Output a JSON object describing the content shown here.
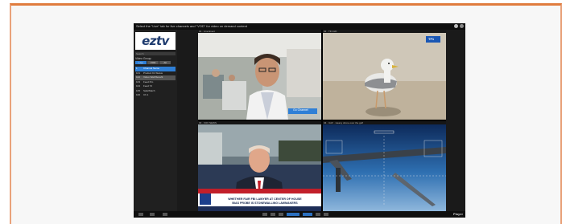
{
  "app": {
    "title_text": "Select the \"Live\" tab for live channels and \"VOD\" for video on demand content",
    "logo": "eztv",
    "search_placeholder": "Search",
    "group_label": "Video Group",
    "sidebar_buttons": [
      "Live",
      "VOD",
      "All"
    ],
    "channels": [
      {
        "num": "1",
        "name": "Channel Name"
      },
      {
        "num": "101",
        "name": "Product Kit Status"
      },
      {
        "num": "102",
        "name": "Video Wall Benefit"
      },
      {
        "num": "103",
        "name": "Feed Pro"
      },
      {
        "num": "104",
        "name": "Feed 72"
      },
      {
        "num": "105",
        "name": "SafeWatch"
      },
      {
        "num": "106",
        "name": "Ch 1"
      }
    ]
  },
  "tiles": [
    {
      "header": "01 · Live Event",
      "overlay_label": "Go Channel"
    },
    {
      "header": "02 · TF1 HD",
      "logo": "TF1"
    },
    {
      "header": "03 · FOX NEWS",
      "headline_line1": "WHETHER FAIR FBI LAWYER AT CENTER OF HOUSE",
      "headline_line2": "BIAS PROBE IS STONEWALLING LAWMAKERS"
    },
    {
      "header": "04 · UAV · Heavy drone over the gulf"
    }
  ],
  "toolbar": {
    "brand": "Player"
  }
}
